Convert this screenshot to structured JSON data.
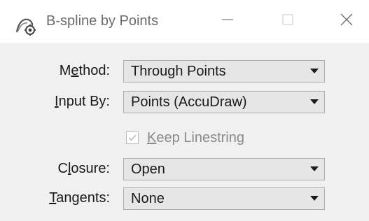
{
  "window": {
    "title": "B-spline by Points",
    "icon": "bspline-tool-icon"
  },
  "controls": {
    "minimize_icon": "minimize-icon",
    "maximize_icon": "maximize-icon",
    "close_icon": "close-icon"
  },
  "form": {
    "method": {
      "label_pre": "M",
      "label_ul": "e",
      "label_post": "thod:",
      "value": "Through Points"
    },
    "input_by": {
      "label_pre": "",
      "label_ul": "I",
      "label_post": "nput By:",
      "value": "Points (AccuDraw)"
    },
    "keep_linestring": {
      "label_pre": "",
      "label_ul": "K",
      "label_post": "eep Linestring",
      "checked": true,
      "enabled": false
    },
    "closure": {
      "label_pre": "C",
      "label_ul": "l",
      "label_post": "osure:",
      "value": "Open"
    },
    "tangents": {
      "label_pre": "",
      "label_ul": "T",
      "label_post": "angents:",
      "value": "None"
    }
  },
  "colors": {
    "content_bg": "#f0f0f0",
    "combo_bg": "#e6e6e6",
    "combo_border": "#adadad",
    "disabled_text": "#8a8a8a"
  }
}
